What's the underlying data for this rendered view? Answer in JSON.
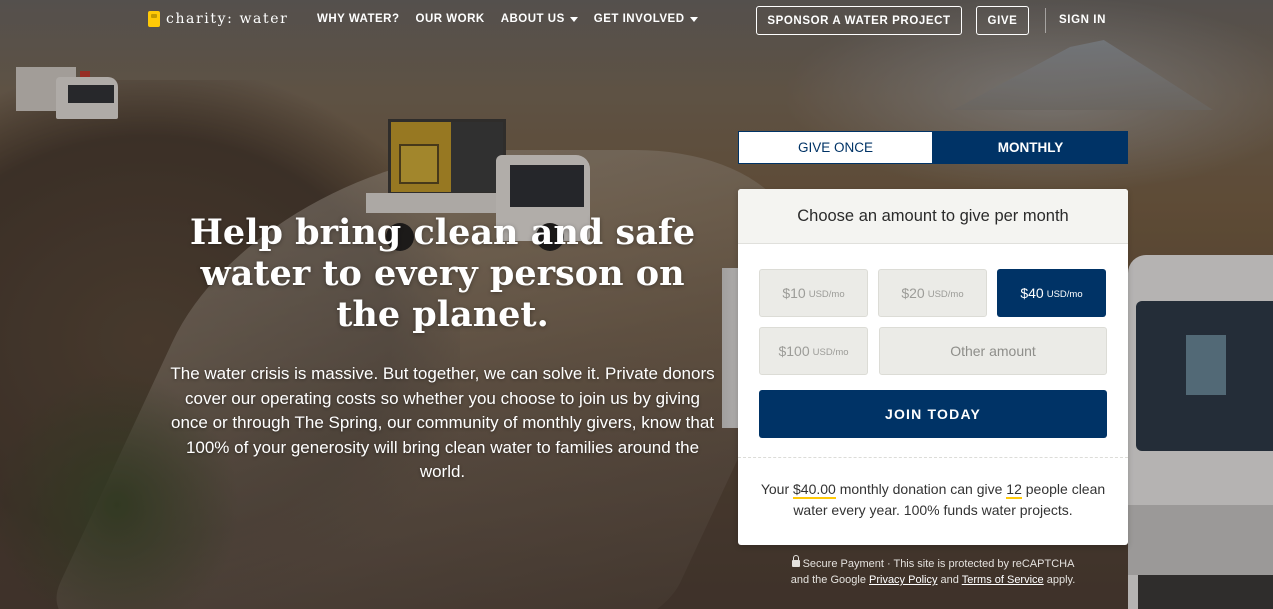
{
  "header": {
    "logo_text": "charity: water",
    "nav": [
      {
        "label": "WHY WATER?",
        "has_caret": false
      },
      {
        "label": "OUR WORK",
        "has_caret": false
      },
      {
        "label": "ABOUT US",
        "has_caret": true
      },
      {
        "label": "GET INVOLVED",
        "has_caret": true
      }
    ],
    "sponsor_label": "SPONSOR A WATER PROJECT",
    "give_label": "GIVE",
    "sign_in_label": "SIGN IN"
  },
  "hero": {
    "title": "Help bring clean and safe water to every person on the planet.",
    "body": "The water crisis is massive. But together, we can solve it. Private donors cover our operating costs so whether you choose to join us by giving once or through The Spring, our community of monthly givers, know that 100% of your generosity will bring clean water to families around the world."
  },
  "donation": {
    "tabs": [
      {
        "label": "GIVE ONCE",
        "active": false
      },
      {
        "label": "MONTHLY",
        "active": true
      }
    ],
    "header": "Choose an amount to give per month",
    "amounts": [
      {
        "value": "$10",
        "unit": "USD/mo",
        "selected": false
      },
      {
        "value": "$20",
        "unit": "USD/mo",
        "selected": false
      },
      {
        "value": "$40",
        "unit": "USD/mo",
        "selected": true
      },
      {
        "value": "$100",
        "unit": "USD/mo",
        "selected": false
      }
    ],
    "other_placeholder": "Other amount",
    "join_label": "JOIN TODAY",
    "impact": {
      "prefix": "Your",
      "amount": "$40.00",
      "middle": "monthly donation can give",
      "people": "12",
      "suffix": "people clean water every year. 100% funds water projects."
    },
    "secure": {
      "line1": "Secure Payment · This site is protected by reCAPTCHA",
      "line2_prefix": "and the Google",
      "privacy_label": "Privacy Policy",
      "and": "and",
      "terms_label": "Terms of Service",
      "line2_suffix": "apply."
    }
  },
  "colors": {
    "navy": "#003366",
    "brand_yellow": "#ffc907"
  }
}
